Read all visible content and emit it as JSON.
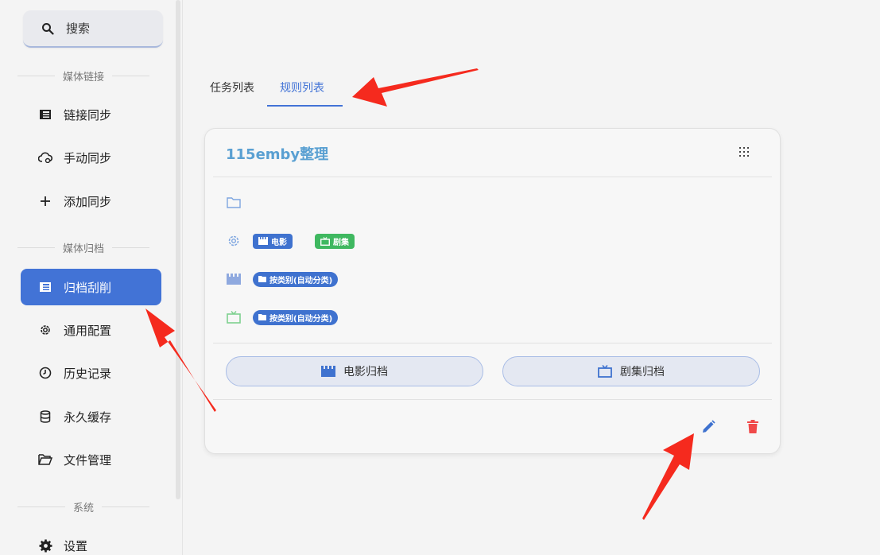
{
  "sidebar": {
    "search_label": "搜索",
    "sections": [
      {
        "title": "媒体链接",
        "items": [
          {
            "label": "链接同步",
            "icon": "table-icon"
          },
          {
            "label": "手动同步",
            "icon": "cloud-sync-icon"
          },
          {
            "label": "添加同步",
            "icon": "plus-icon"
          }
        ]
      },
      {
        "title": "媒体归档",
        "items": [
          {
            "label": "归档刮削",
            "icon": "table-icon",
            "active": true
          },
          {
            "label": "通用配置",
            "icon": "gear-icon"
          },
          {
            "label": "历史记录",
            "icon": "clock-icon"
          },
          {
            "label": "永久缓存",
            "icon": "database-icon"
          },
          {
            "label": "文件管理",
            "icon": "folder-open-icon"
          }
        ]
      },
      {
        "title": "系统",
        "items": [
          {
            "label": "设置",
            "icon": "gear-icon"
          }
        ]
      }
    ]
  },
  "tabs": [
    {
      "label": "任务列表",
      "active": false
    },
    {
      "label": "规则列表",
      "active": true
    }
  ],
  "card": {
    "title": "115emby整理",
    "chip_movie": "电影",
    "chip_tv": "剧集",
    "movie_rule": "按类别(自动分类)",
    "tv_rule": "按类别(自动分类)",
    "movie_archive_button": "电影归档",
    "tv_archive_button": "剧集归档"
  },
  "colors": {
    "accent": "#4273d6",
    "title": "#5aa0d2",
    "green": "#3fb860",
    "danger": "#f04a4a",
    "annotation_arrow": "#f52a1e"
  }
}
